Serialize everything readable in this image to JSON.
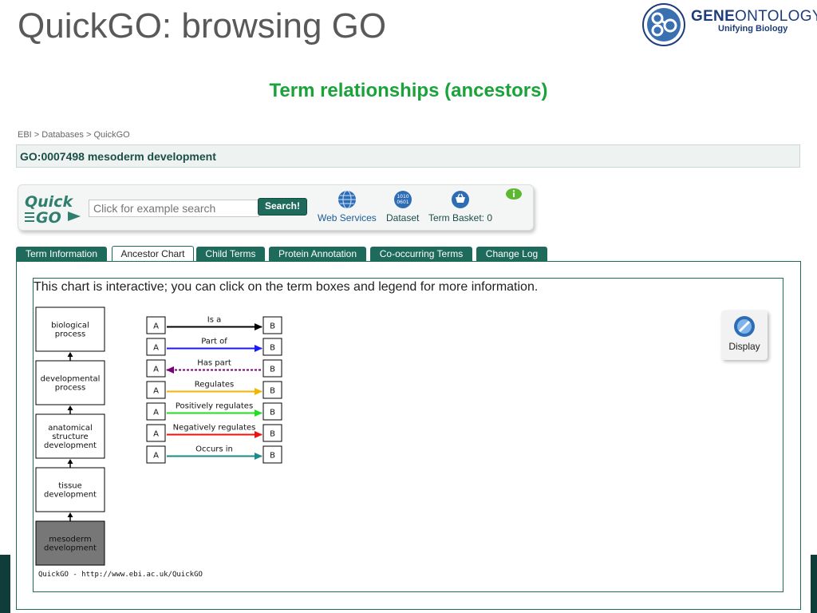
{
  "slide": {
    "title": "QuickGO: browsing GO",
    "subtitle": "Term relationships (ancestors)",
    "logo": {
      "icon": "go-logo-icon",
      "brand_gene": "GENE",
      "brand_ontology": "ONTOLOGY",
      "tagline": "Unifying Biology"
    }
  },
  "breadcrumb": {
    "items": [
      "EBI",
      "Databases",
      "QuickGO"
    ],
    "separator": ">"
  },
  "term": {
    "header": "GO:0007498 mesoderm development"
  },
  "toolbar": {
    "search_placeholder": "Click for example search",
    "search_button": "Search!",
    "web_services": "Web Services",
    "dataset": "Dataset",
    "term_basket": "Term Basket: 0",
    "dataset_icon_text": "1010"
  },
  "tabs": [
    {
      "label": "Term Information",
      "active": false
    },
    {
      "label": "Ancestor Chart",
      "active": true
    },
    {
      "label": "Child Terms",
      "active": false
    },
    {
      "label": "Protein Annotation",
      "active": false
    },
    {
      "label": "Co-occurring Terms",
      "active": false
    },
    {
      "label": "Change Log",
      "active": false
    }
  ],
  "chart": {
    "intro": "This chart is interactive; you can click on the term boxes and legend for more information.",
    "terms": [
      {
        "lines": [
          "biological",
          "process"
        ],
        "highlighted": false
      },
      {
        "lines": [
          "developmental",
          "process"
        ],
        "highlighted": false
      },
      {
        "lines": [
          "anatomical",
          "structure",
          "development"
        ],
        "highlighted": false
      },
      {
        "lines": [
          "tissue",
          "development"
        ],
        "highlighted": false
      },
      {
        "lines": [
          "mesoderm",
          "development"
        ],
        "highlighted": true
      }
    ],
    "legend": [
      {
        "label": "Is a",
        "color": "#000000",
        "dashed": false,
        "reverse": false
      },
      {
        "label": "Part of",
        "color": "#1a1aff",
        "dashed": false,
        "reverse": false
      },
      {
        "label": "Has part",
        "color": "#7a007a",
        "dashed": true,
        "reverse": true
      },
      {
        "label": "Regulates",
        "color": "#f2b600",
        "dashed": false,
        "reverse": false
      },
      {
        "label": "Positively regulates",
        "color": "#22dd22",
        "dashed": false,
        "reverse": false
      },
      {
        "label": "Negatively regulates",
        "color": "#ee1111",
        "dashed": false,
        "reverse": false
      },
      {
        "label": "Occurs in",
        "color": "#1a8a8a",
        "dashed": false,
        "reverse": false
      }
    ],
    "legend_box_a": "A",
    "legend_box_b": "B",
    "display_button": "Display",
    "footer": "QuickGO - http://www.ebi.ac.uk/QuickGO"
  },
  "colors": {
    "title_gray": "#595959",
    "subtitle_green": "#1aa33a",
    "tab_teal": "#1e6b5c",
    "header_teal": "#1b4e47",
    "highlight_box": "#777777"
  }
}
